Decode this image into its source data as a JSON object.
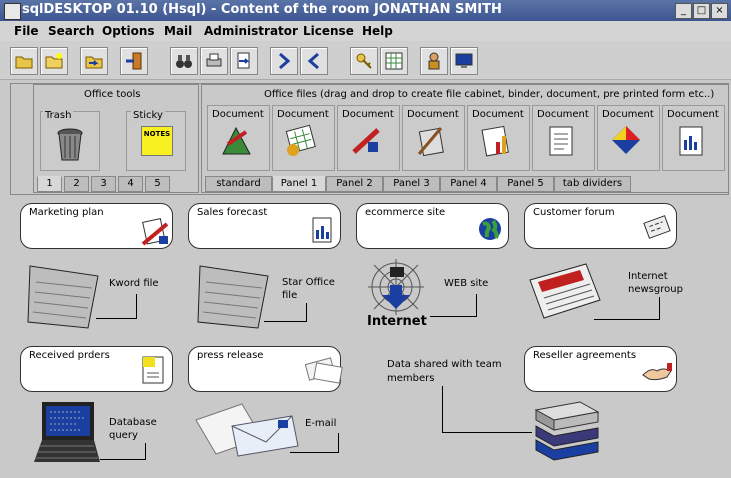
{
  "window": {
    "title": "sqlDESKTOP 01.10  (Hsql)  - Content of the room   JONATHAN SMITH"
  },
  "menu": [
    "File",
    "Search",
    "Options",
    "Mail",
    "Administrator",
    "License",
    "Help"
  ],
  "office_tools": {
    "title": "Office tools",
    "trash_label": "Trash",
    "sticky_label": "Sticky",
    "sticky_note": "NOTES",
    "tabs": [
      "1",
      "2",
      "3",
      "4",
      "5"
    ]
  },
  "office_files": {
    "title": "Office files (drag and drop to create file cabinet, binder, document, pre printed form etc..)",
    "document_label": "Document",
    "tabs": [
      "standard",
      "Panel 1",
      "Panel 2",
      "Panel 3",
      "Panel 4",
      "Panel 5",
      "tab dividers"
    ]
  },
  "items": {
    "marketing": "Marketing plan",
    "sales": "Sales forecast",
    "ecommerce": "ecommerce site",
    "forum": "Customer forum",
    "received": "Received prders",
    "press": "press release",
    "reseller": "Reseller agreements"
  },
  "labels": {
    "kword": "Kword file",
    "staroffice": "Star Office\nfile",
    "web": "WEB site",
    "internet": "Internet",
    "newsgroup": "Internet\nnewsgroup",
    "database": "Database\nquery",
    "email": "E-mail",
    "shared": "Data shared with team\nmembers"
  },
  "colors": {
    "titlebar": "#3d5590",
    "accent": "#1a3fa0"
  }
}
